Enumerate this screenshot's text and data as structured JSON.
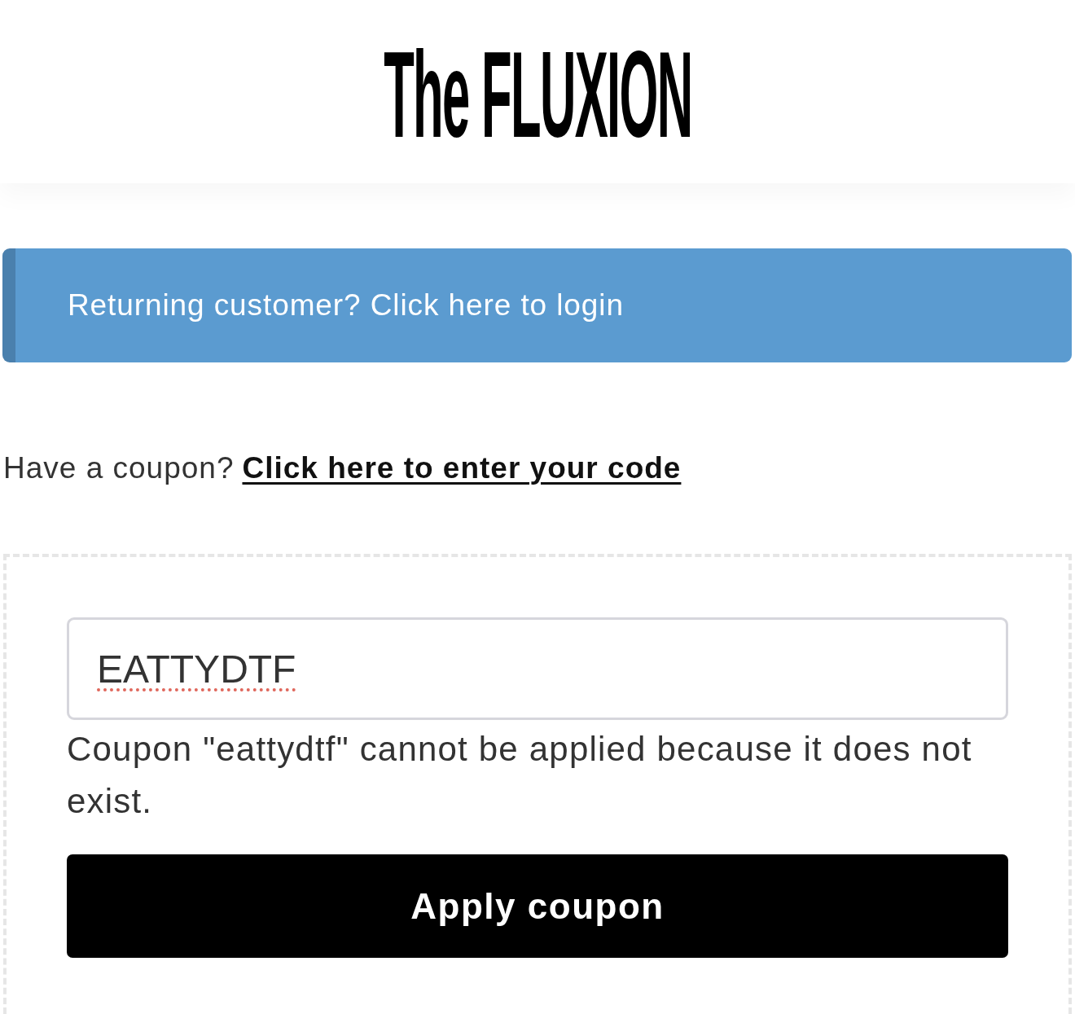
{
  "header": {
    "logo": "The FLUXION"
  },
  "login_notice": {
    "text": "Returning customer? Click here to login"
  },
  "coupon_prompt": {
    "text": "Have a coupon?",
    "link": "Click here to enter your code"
  },
  "coupon_form": {
    "input": {
      "value": "EATTYDTF",
      "misspelled": true
    },
    "error": "Coupon \"eattydtf\" cannot be applied because it does not exist.",
    "button": "Apply coupon"
  }
}
